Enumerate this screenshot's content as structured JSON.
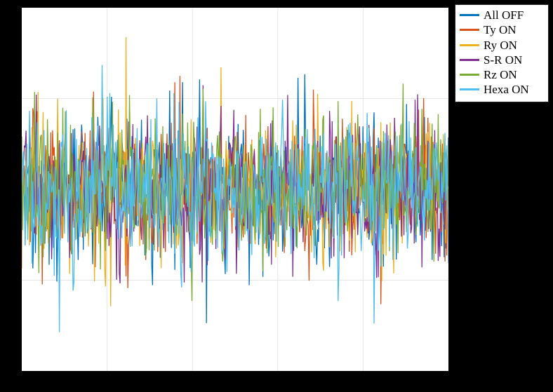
{
  "chart_data": {
    "type": "line",
    "title": "",
    "xlabel": "",
    "ylabel": "",
    "xlim": [
      0,
      500
    ],
    "ylim": [
      -1.3,
      1.3
    ],
    "grid": {
      "x_ticks": 5,
      "y_ticks": 4,
      "color": "#e6e6e6"
    },
    "note": "Dense overlapping noise/time-series traces; per-point values are not readable and are synthetically reproduced with matching amplitude envelope and colors.",
    "series": [
      {
        "name": "All OFF",
        "color": "#0072BD",
        "n": 500,
        "amp": 1.0
      },
      {
        "name": "Ty ON",
        "color": "#D95319",
        "n": 500,
        "amp": 0.98
      },
      {
        "name": "Ry ON",
        "color": "#EDB120",
        "n": 500,
        "amp": 0.96
      },
      {
        "name": "S-R ON",
        "color": "#7E2F8E",
        "n": 500,
        "amp": 0.97
      },
      {
        "name": "Rz ON",
        "color": "#77AC30",
        "n": 500,
        "amp": 0.99
      },
      {
        "name": "Hexa ON",
        "color": "#4DBEEE",
        "n": 500,
        "amp": 1.0
      }
    ]
  },
  "legend_title": ""
}
